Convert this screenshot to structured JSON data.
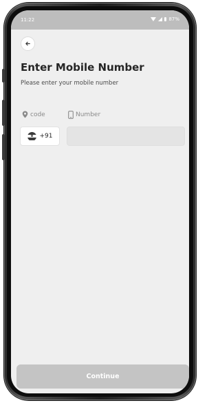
{
  "status_bar": {
    "time": "11:22",
    "battery": "87%"
  },
  "header": {
    "title": "Enter Mobile Number",
    "subtitle": "Please enter your mobile number"
  },
  "form": {
    "code_label": "code",
    "number_label": "Number",
    "country_code": "+91",
    "number_value": "",
    "number_placeholder": ""
  },
  "footer": {
    "continue_label": "Continue"
  },
  "icons": {
    "back": "arrow-left-icon",
    "code": "location-pin-icon",
    "number": "mobile-phone-icon",
    "flag": "india-flag-icon"
  },
  "colors": {
    "screen_bg": "#efefef",
    "status_bar_bg": "#bdbdbd",
    "title_text": "#262626",
    "muted_text": "#8a8a8a",
    "input_bg": "#e4e4e4",
    "button_disabled_bg": "#c4c4c4",
    "button_text": "#ffffff",
    "flag_saffron": "#3a3a3a",
    "flag_white": "#ffffff",
    "flag_green": "#3a3a3a"
  }
}
